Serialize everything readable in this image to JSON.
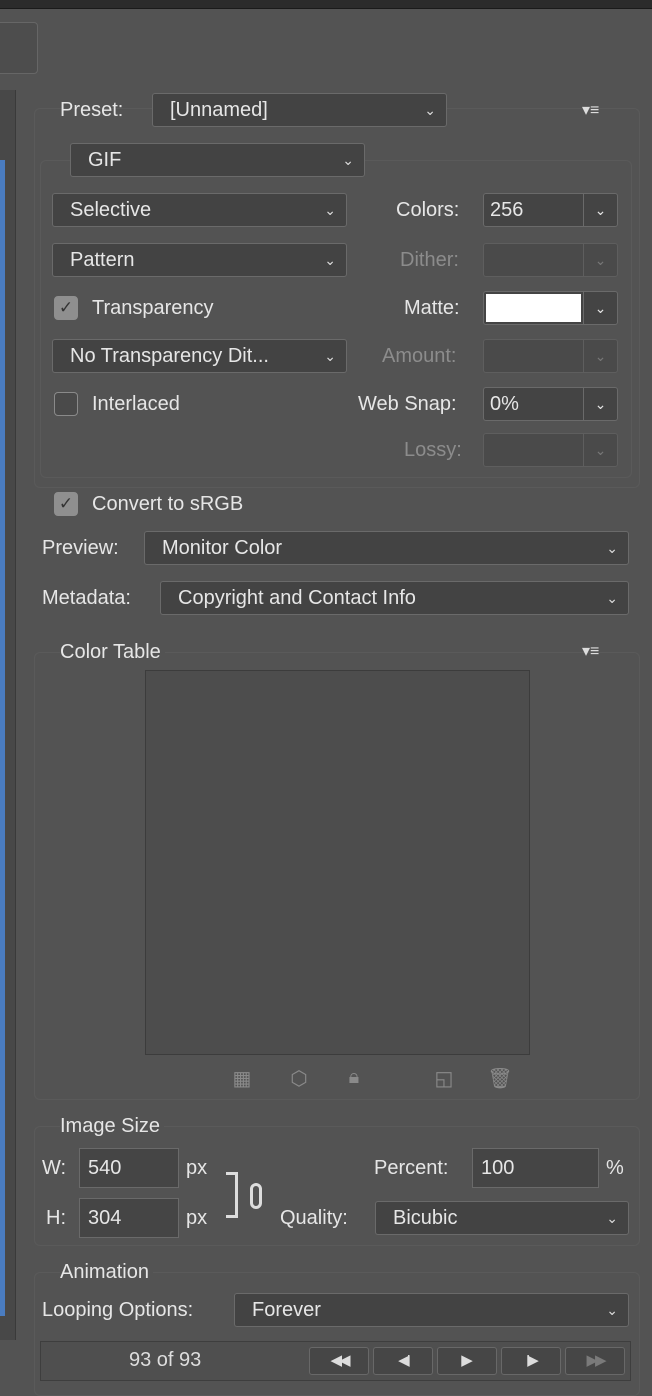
{
  "preset": {
    "label": "Preset:",
    "value": "[Unnamed]"
  },
  "format": {
    "value": "GIF"
  },
  "reduction": {
    "value": "Selective"
  },
  "colors": {
    "label": "Colors:",
    "value": "256"
  },
  "dither_algo": {
    "value": "Pattern"
  },
  "dither": {
    "label": "Dither:",
    "value": ""
  },
  "transparency": {
    "label": "Transparency",
    "checked": true
  },
  "matte": {
    "label": "Matte:",
    "color": "#ffffff"
  },
  "transparency_dither": {
    "value": "No Transparency Dit..."
  },
  "amount": {
    "label": "Amount:",
    "value": ""
  },
  "interlaced": {
    "label": "Interlaced",
    "checked": false
  },
  "web_snap": {
    "label": "Web Snap:",
    "value": "0%"
  },
  "lossy": {
    "label": "Lossy:",
    "value": ""
  },
  "convert_srgb": {
    "label": "Convert to sRGB",
    "checked": true
  },
  "preview": {
    "label": "Preview:",
    "value": "Monitor Color"
  },
  "metadata": {
    "label": "Metadata:",
    "value": "Copyright and Contact Info"
  },
  "color_table": {
    "title": "Color Table",
    "icons": [
      "transparency-checker-icon",
      "web-cube-icon",
      "lock-icon",
      "new-color-icon",
      "trash-icon"
    ]
  },
  "image_size": {
    "title": "Image Size",
    "w_label": "W:",
    "w": "540",
    "h_label": "H:",
    "h": "304",
    "unit": "px",
    "percent_label": "Percent:",
    "percent": "100",
    "percent_unit": "%",
    "quality_label": "Quality:",
    "quality": "Bicubic"
  },
  "animation": {
    "title": "Animation",
    "looping_label": "Looping Options:",
    "looping": "Forever",
    "frame_counter": "93 of 93"
  },
  "glyphs": {
    "check": "✓",
    "chev": "⌄",
    "menu": "▾≡",
    "first": "◀◀",
    "prev": "◀I",
    "play": "▶",
    "next": "I▶",
    "last": "▶▶"
  }
}
